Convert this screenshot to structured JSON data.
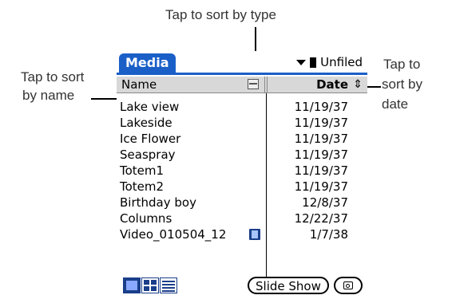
{
  "callouts": {
    "type": "Tap to sort by type",
    "name_line1": "Tap to sort",
    "name_line2": "by name",
    "date_line1": "Tap to",
    "date_line2": "sort by",
    "date_line3": "date"
  },
  "app": {
    "title": "Media",
    "category": "Unfiled",
    "accent_color": "#1a5fc8"
  },
  "columns": {
    "name": "Name",
    "date": "Date"
  },
  "icons": {
    "type_sort": "film-icon",
    "date_sort": "sort-arrow-icon",
    "category": "dropdown-triangle-icon"
  },
  "items": [
    {
      "name": "Lake view",
      "date": "11/19/37",
      "is_video": false
    },
    {
      "name": "Lakeside",
      "date": "11/19/37",
      "is_video": false
    },
    {
      "name": "Ice Flower",
      "date": "11/19/37",
      "is_video": false
    },
    {
      "name": "Seaspray",
      "date": "11/19/37",
      "is_video": false
    },
    {
      "name": "Totem1",
      "date": "11/19/37",
      "is_video": false
    },
    {
      "name": "Totem2",
      "date": "11/19/37",
      "is_video": false
    },
    {
      "name": "Birthday boy",
      "date": "12/8/37",
      "is_video": false
    },
    {
      "name": "Columns",
      "date": "12/22/37",
      "is_video": false
    },
    {
      "name": "Video_010504_12",
      "date": "1/7/38",
      "is_video": true
    }
  ],
  "bottom": {
    "slideshow_label": "Slide Show"
  }
}
